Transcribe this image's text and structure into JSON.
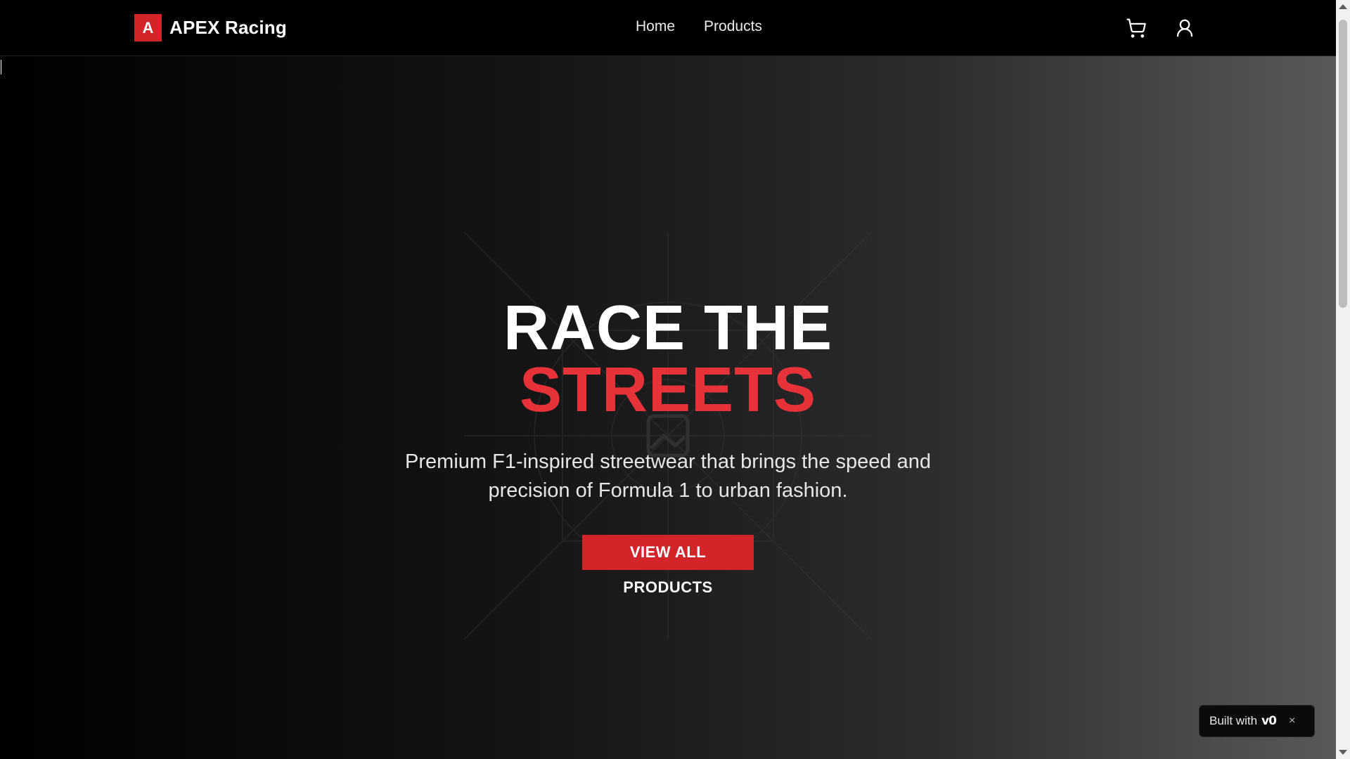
{
  "brand": {
    "mark": "A",
    "name": "APEX Racing",
    "accent_color": "#d3242a"
  },
  "nav": {
    "links": [
      {
        "label": "Home"
      },
      {
        "label": "Products"
      }
    ],
    "icons": [
      "cart-icon",
      "user-icon"
    ]
  },
  "hero": {
    "title_line1": "RACE THE",
    "title_line2": "STREETS",
    "title_line2_color": "#e8323a",
    "subtitle": "Premium F1-inspired streetwear that brings the speed and precision of Formula 1 to urban fashion.",
    "cta_label": "VIEW ALL PRODUCTS",
    "background_icon": "image-placeholder-icon"
  },
  "badge": {
    "text": "Built with",
    "logo": "v0",
    "close": "×"
  }
}
